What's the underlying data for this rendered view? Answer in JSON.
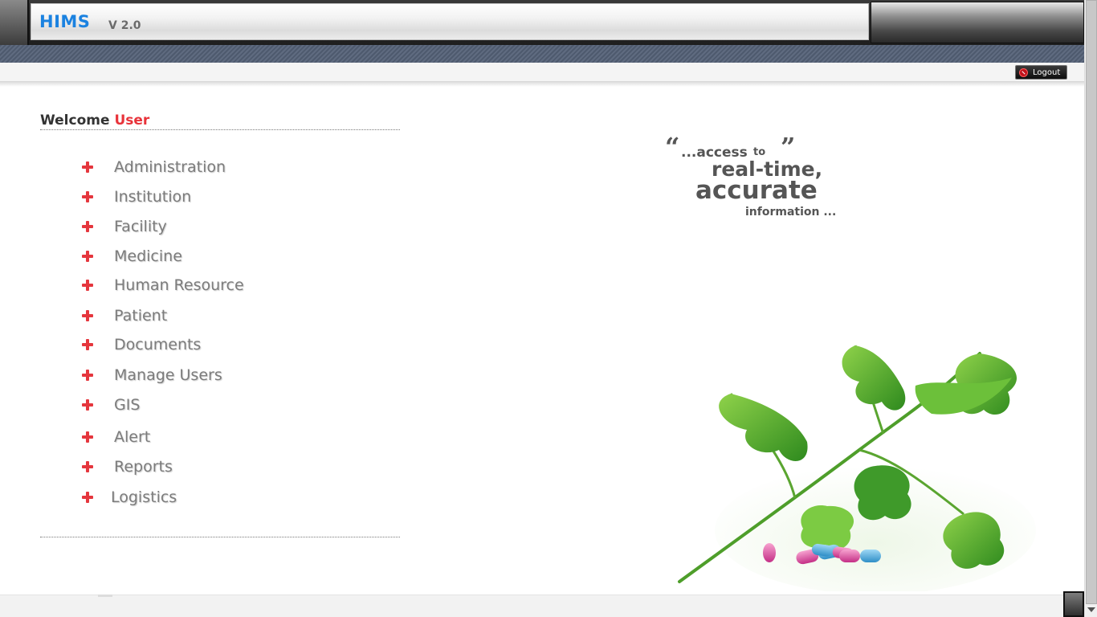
{
  "header": {
    "app_title": "HIMS",
    "app_version": "V 2.0"
  },
  "toolbar": {
    "logout_label": "Logout",
    "logout_icon": "power-icon"
  },
  "welcome": {
    "greeting": "Welcome",
    "user": "User"
  },
  "menu": {
    "icon": "plus-icon",
    "items": [
      {
        "label": "Administration"
      },
      {
        "label": "Institution"
      },
      {
        "label": "Facility"
      },
      {
        "label": "Medicine"
      },
      {
        "label": "Human Resource"
      },
      {
        "label": "Patient"
      },
      {
        "label": "Documents"
      },
      {
        "label": "Manage Users"
      },
      {
        "label": "GIS"
      },
      {
        "label": "Alert"
      },
      {
        "label": "Reports"
      },
      {
        "label": "Logistics"
      }
    ]
  },
  "quote": {
    "open_mark": "“",
    "line1": "...access",
    "to": "to",
    "close_mark": "”",
    "line2": "real-time,",
    "line3": "accurate",
    "line4": "information ..."
  },
  "colors": {
    "accent_blue": "#1b82e0",
    "accent_red": "#e5363d",
    "menu_text": "#7c7c7c",
    "leaf_green": "#3f9a2a"
  }
}
